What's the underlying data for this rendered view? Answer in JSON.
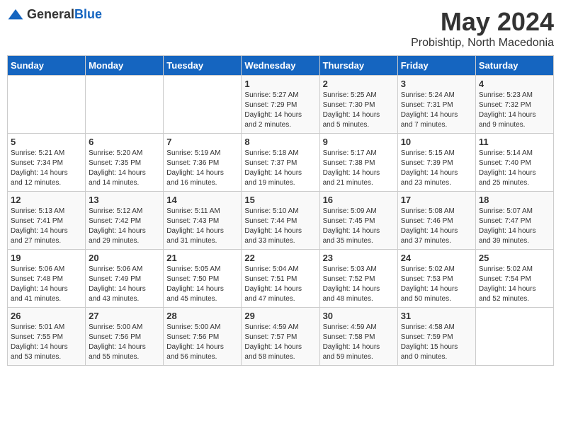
{
  "header": {
    "logo_general": "General",
    "logo_blue": "Blue",
    "month": "May 2024",
    "location": "Probishtip, North Macedonia"
  },
  "weekdays": [
    "Sunday",
    "Monday",
    "Tuesday",
    "Wednesday",
    "Thursday",
    "Friday",
    "Saturday"
  ],
  "weeks": [
    {
      "days": [
        {
          "number": "",
          "info": ""
        },
        {
          "number": "",
          "info": ""
        },
        {
          "number": "",
          "info": ""
        },
        {
          "number": "1",
          "info": "Sunrise: 5:27 AM\nSunset: 7:29 PM\nDaylight: 14 hours\nand 2 minutes."
        },
        {
          "number": "2",
          "info": "Sunrise: 5:25 AM\nSunset: 7:30 PM\nDaylight: 14 hours\nand 5 minutes."
        },
        {
          "number": "3",
          "info": "Sunrise: 5:24 AM\nSunset: 7:31 PM\nDaylight: 14 hours\nand 7 minutes."
        },
        {
          "number": "4",
          "info": "Sunrise: 5:23 AM\nSunset: 7:32 PM\nDaylight: 14 hours\nand 9 minutes."
        }
      ]
    },
    {
      "days": [
        {
          "number": "5",
          "info": "Sunrise: 5:21 AM\nSunset: 7:34 PM\nDaylight: 14 hours\nand 12 minutes."
        },
        {
          "number": "6",
          "info": "Sunrise: 5:20 AM\nSunset: 7:35 PM\nDaylight: 14 hours\nand 14 minutes."
        },
        {
          "number": "7",
          "info": "Sunrise: 5:19 AM\nSunset: 7:36 PM\nDaylight: 14 hours\nand 16 minutes."
        },
        {
          "number": "8",
          "info": "Sunrise: 5:18 AM\nSunset: 7:37 PM\nDaylight: 14 hours\nand 19 minutes."
        },
        {
          "number": "9",
          "info": "Sunrise: 5:17 AM\nSunset: 7:38 PM\nDaylight: 14 hours\nand 21 minutes."
        },
        {
          "number": "10",
          "info": "Sunrise: 5:15 AM\nSunset: 7:39 PM\nDaylight: 14 hours\nand 23 minutes."
        },
        {
          "number": "11",
          "info": "Sunrise: 5:14 AM\nSunset: 7:40 PM\nDaylight: 14 hours\nand 25 minutes."
        }
      ]
    },
    {
      "days": [
        {
          "number": "12",
          "info": "Sunrise: 5:13 AM\nSunset: 7:41 PM\nDaylight: 14 hours\nand 27 minutes."
        },
        {
          "number": "13",
          "info": "Sunrise: 5:12 AM\nSunset: 7:42 PM\nDaylight: 14 hours\nand 29 minutes."
        },
        {
          "number": "14",
          "info": "Sunrise: 5:11 AM\nSunset: 7:43 PM\nDaylight: 14 hours\nand 31 minutes."
        },
        {
          "number": "15",
          "info": "Sunrise: 5:10 AM\nSunset: 7:44 PM\nDaylight: 14 hours\nand 33 minutes."
        },
        {
          "number": "16",
          "info": "Sunrise: 5:09 AM\nSunset: 7:45 PM\nDaylight: 14 hours\nand 35 minutes."
        },
        {
          "number": "17",
          "info": "Sunrise: 5:08 AM\nSunset: 7:46 PM\nDaylight: 14 hours\nand 37 minutes."
        },
        {
          "number": "18",
          "info": "Sunrise: 5:07 AM\nSunset: 7:47 PM\nDaylight: 14 hours\nand 39 minutes."
        }
      ]
    },
    {
      "days": [
        {
          "number": "19",
          "info": "Sunrise: 5:06 AM\nSunset: 7:48 PM\nDaylight: 14 hours\nand 41 minutes."
        },
        {
          "number": "20",
          "info": "Sunrise: 5:06 AM\nSunset: 7:49 PM\nDaylight: 14 hours\nand 43 minutes."
        },
        {
          "number": "21",
          "info": "Sunrise: 5:05 AM\nSunset: 7:50 PM\nDaylight: 14 hours\nand 45 minutes."
        },
        {
          "number": "22",
          "info": "Sunrise: 5:04 AM\nSunset: 7:51 PM\nDaylight: 14 hours\nand 47 minutes."
        },
        {
          "number": "23",
          "info": "Sunrise: 5:03 AM\nSunset: 7:52 PM\nDaylight: 14 hours\nand 48 minutes."
        },
        {
          "number": "24",
          "info": "Sunrise: 5:02 AM\nSunset: 7:53 PM\nDaylight: 14 hours\nand 50 minutes."
        },
        {
          "number": "25",
          "info": "Sunrise: 5:02 AM\nSunset: 7:54 PM\nDaylight: 14 hours\nand 52 minutes."
        }
      ]
    },
    {
      "days": [
        {
          "number": "26",
          "info": "Sunrise: 5:01 AM\nSunset: 7:55 PM\nDaylight: 14 hours\nand 53 minutes."
        },
        {
          "number": "27",
          "info": "Sunrise: 5:00 AM\nSunset: 7:56 PM\nDaylight: 14 hours\nand 55 minutes."
        },
        {
          "number": "28",
          "info": "Sunrise: 5:00 AM\nSunset: 7:56 PM\nDaylight: 14 hours\nand 56 minutes."
        },
        {
          "number": "29",
          "info": "Sunrise: 4:59 AM\nSunset: 7:57 PM\nDaylight: 14 hours\nand 58 minutes."
        },
        {
          "number": "30",
          "info": "Sunrise: 4:59 AM\nSunset: 7:58 PM\nDaylight: 14 hours\nand 59 minutes."
        },
        {
          "number": "31",
          "info": "Sunrise: 4:58 AM\nSunset: 7:59 PM\nDaylight: 15 hours\nand 0 minutes."
        },
        {
          "number": "",
          "info": ""
        }
      ]
    }
  ]
}
